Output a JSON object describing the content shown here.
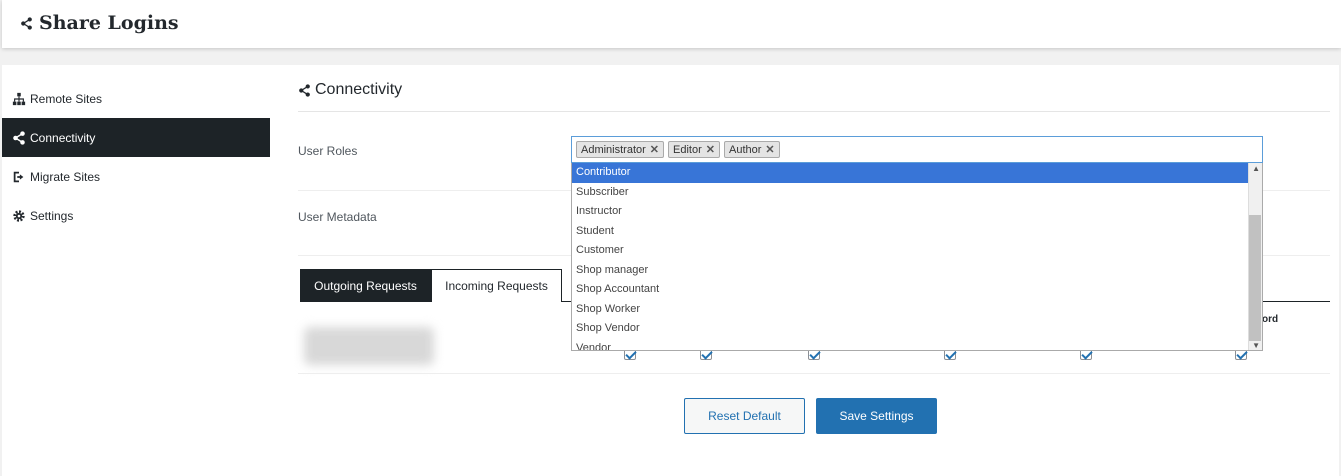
{
  "app": {
    "title": "Share Logins"
  },
  "sidebar": {
    "items": [
      {
        "label": "Remote Sites",
        "icon": "sitemap-icon",
        "active": false
      },
      {
        "label": "Connectivity",
        "icon": "share-icon",
        "active": true
      },
      {
        "label": "Migrate Sites",
        "icon": "sign-out-icon",
        "active": false
      },
      {
        "label": "Settings",
        "icon": "gear-icon",
        "active": false
      }
    ]
  },
  "main": {
    "section_title": "Connectivity",
    "user_roles_label": "User Roles",
    "user_metadata_label": "User Metadata",
    "selected_roles": [
      "Administrator",
      "Editor",
      "Author"
    ],
    "remove_glyph": "✕",
    "role_options": [
      "Contributor",
      "Subscriber",
      "Instructor",
      "Student",
      "Customer",
      "Shop manager",
      "Shop Accountant",
      "Shop Worker",
      "Shop Vendor",
      "Vendor"
    ],
    "highlighted_option": "Contributor",
    "tabs": [
      {
        "label": "Outgoing Requests",
        "active": true
      },
      {
        "label": "Incoming Requests",
        "active": false
      }
    ],
    "partial_column_header": "ord",
    "reset_label": "Reset Default",
    "save_label": "Save Settings"
  },
  "colors": {
    "primary": "#2271b1",
    "dark": "#1d2327",
    "highlight": "#3875d7"
  }
}
